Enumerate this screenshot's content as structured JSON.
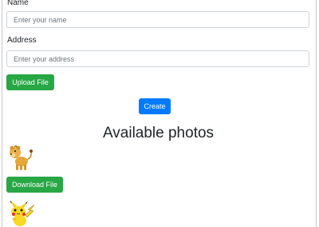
{
  "form": {
    "name_label": "Name",
    "name_placeholder": "Enter your name",
    "address_label": "Address",
    "address_placeholder": "Enter your address",
    "upload_label": "Upload File",
    "create_label": "Create"
  },
  "photos": {
    "heading": "Available photos",
    "download_label": "Download File",
    "items": [
      {
        "icon": "lion-cub-icon"
      },
      {
        "icon": "pikachu-icon"
      }
    ]
  },
  "colors": {
    "success": "#28a745",
    "primary": "#007bff",
    "input_border": "#ced4da"
  }
}
